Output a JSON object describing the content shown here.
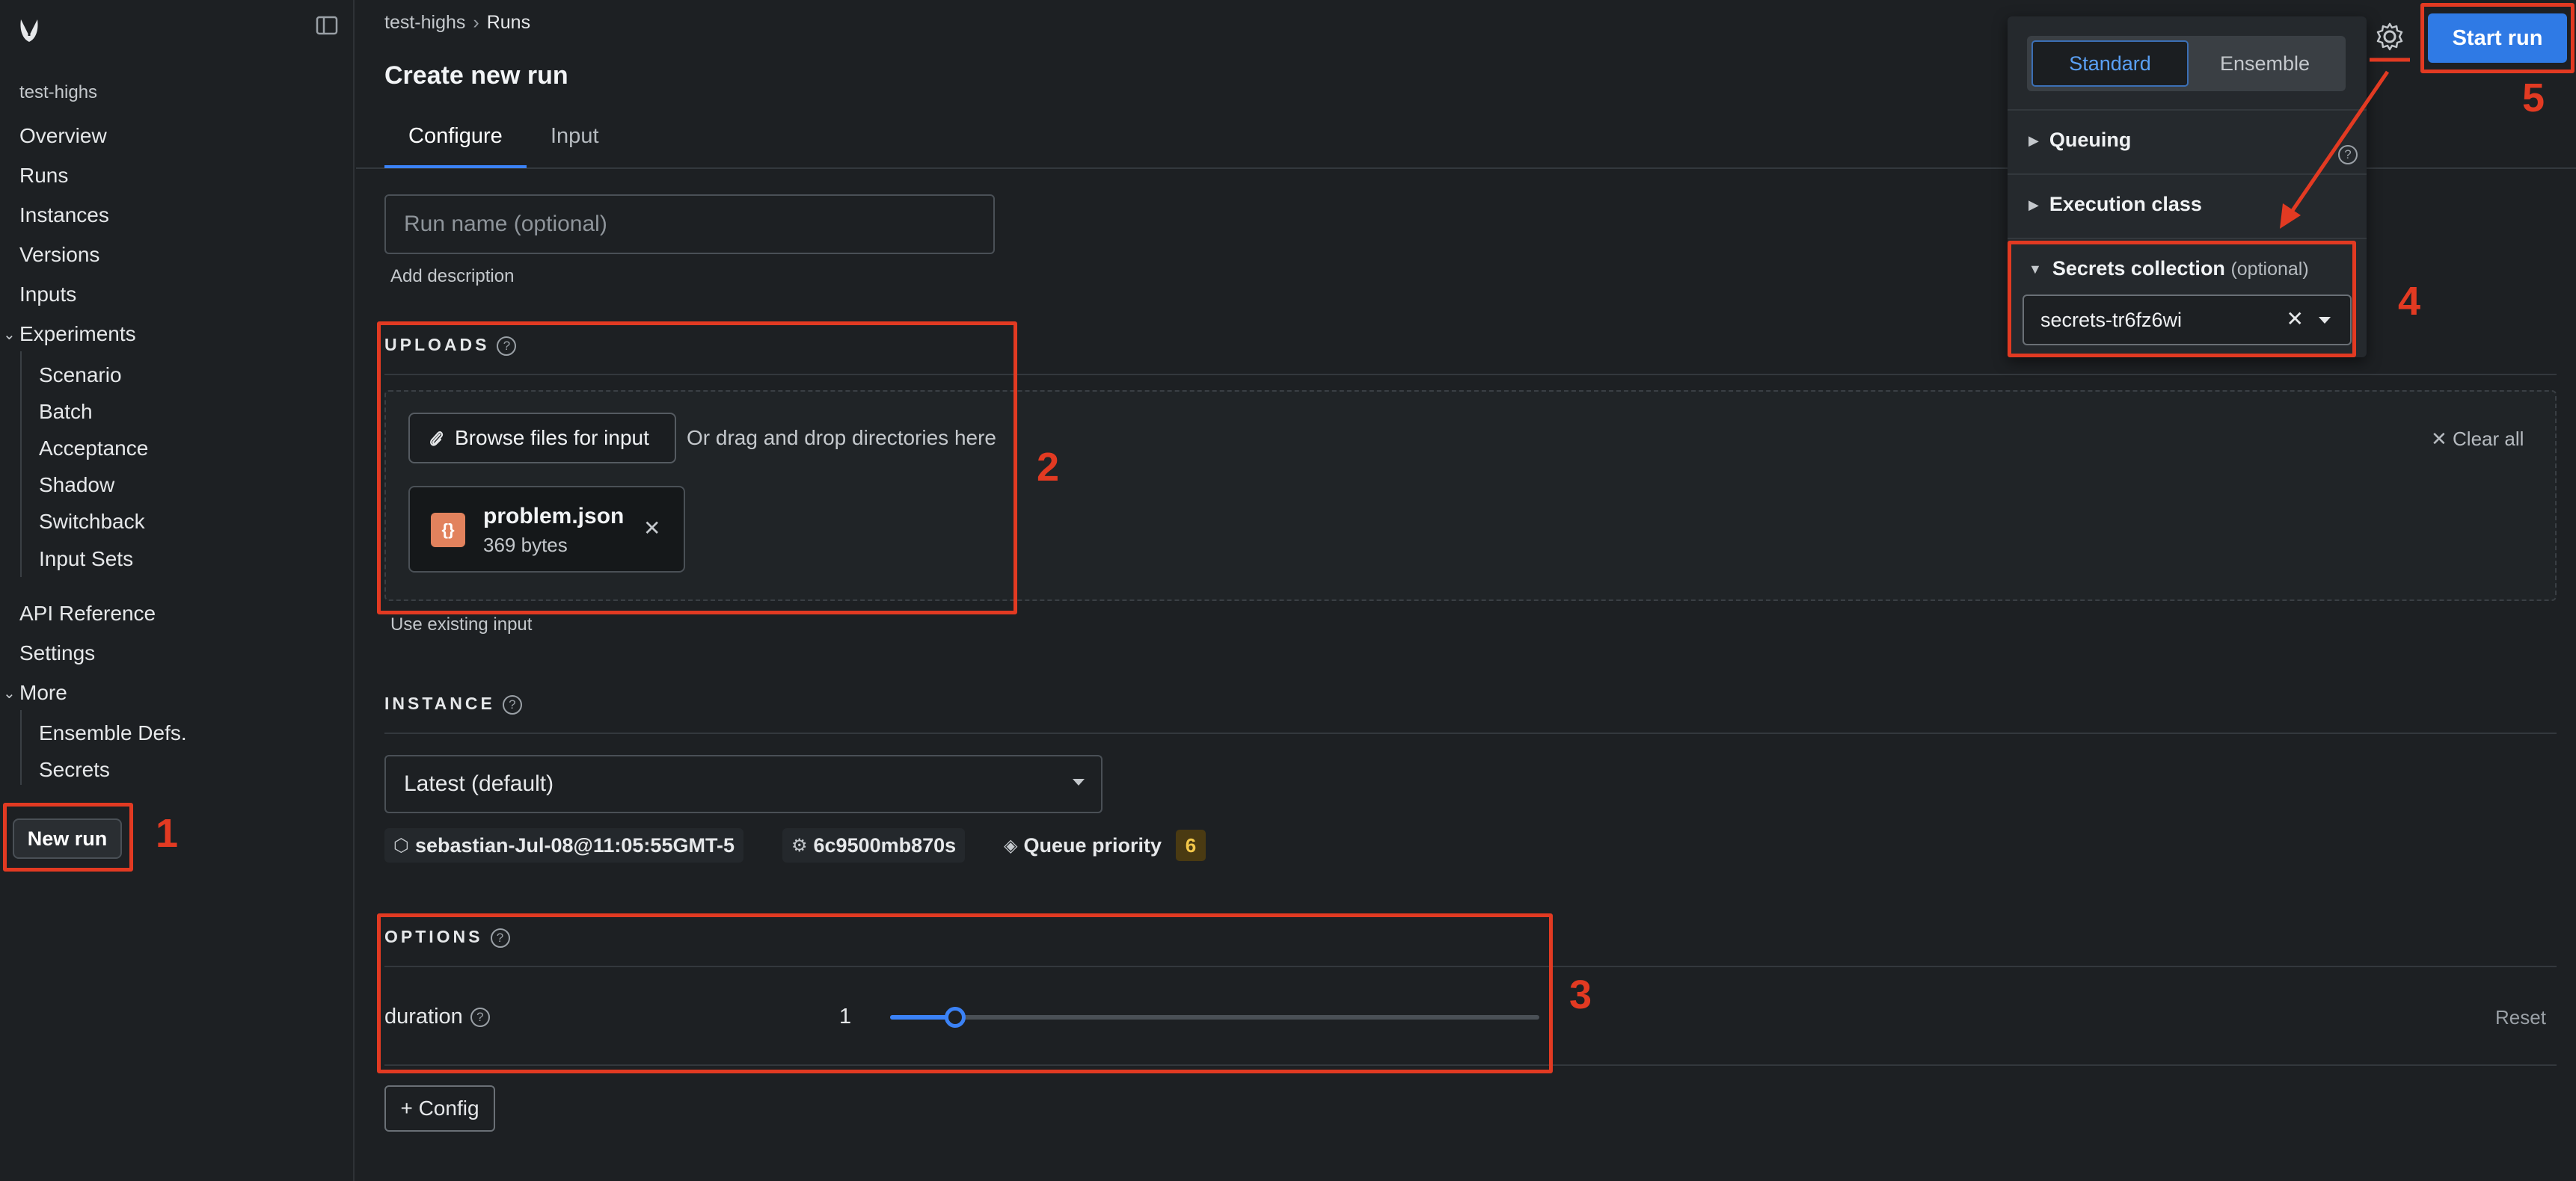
{
  "sidebar": {
    "project": "test-highs",
    "nav": {
      "overview": "Overview",
      "runs": "Runs",
      "instances": "Instances",
      "versions": "Versions",
      "inputs": "Inputs",
      "experiments": "Experiments",
      "experiments_items": [
        "Scenario",
        "Batch",
        "Acceptance",
        "Shadow",
        "Switchback",
        "Input Sets"
      ],
      "api_reference": "API Reference",
      "settings": "Settings",
      "more": "More",
      "more_items": [
        "Ensemble Defs.",
        "Secrets"
      ]
    },
    "new_run": "New run"
  },
  "breadcrumb": {
    "project": "test-highs",
    "page": "Runs"
  },
  "page_title": "Create new run",
  "tabs": [
    {
      "label": "Configure",
      "active": true
    },
    {
      "label": "Input",
      "active": false
    }
  ],
  "run_name": {
    "placeholder": "Run name (optional)",
    "value": ""
  },
  "add_description": "Add description",
  "uploads": {
    "label": "UPLOADS",
    "browse_label": "Browse files for input",
    "drag_text": "Or drag and drop directories here",
    "clear_all": "Clear all",
    "file": {
      "name": "problem.json",
      "size": "369 bytes"
    },
    "use_existing": "Use existing input"
  },
  "instance": {
    "label": "INSTANCE",
    "selected": "Latest (default)",
    "version_chip": "sebastian-Jul-08@11:05:55GMT-5",
    "id_chip": "6c9500mb870s",
    "queue_label": "Queue priority",
    "queue_value": "6"
  },
  "options": {
    "label": "OPTIONS",
    "duration_label": "duration",
    "duration_value": "1",
    "slider_fraction": 0.1,
    "reset": "Reset",
    "add_config": "+ Config"
  },
  "popover": {
    "modes": [
      "Standard",
      "Ensemble"
    ],
    "active_mode": "Standard",
    "queuing": "Queuing",
    "execution_class": "Execution class",
    "secrets_collection": "Secrets collection",
    "optional": "(optional)",
    "secrets_value": "secrets-tr6fz6wi"
  },
  "start_run": "Start run",
  "annotations": [
    "1",
    "2",
    "3",
    "4",
    "5"
  ],
  "colors": {
    "accent": "#3b82f6",
    "annotation": "#e23a22",
    "background": "#1d2023"
  }
}
